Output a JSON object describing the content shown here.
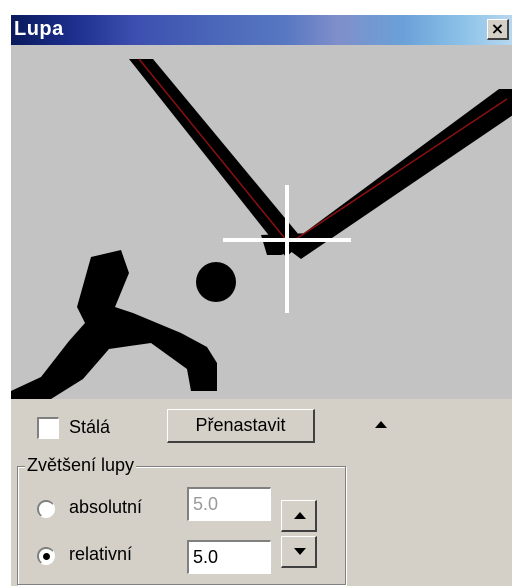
{
  "window": {
    "title": "Lupa",
    "close_icon": "close-icon",
    "close_glyph": "×"
  },
  "magnifier": {
    "crosshair_icon": "crosshair-icon",
    "colors": {
      "background": "#c3c3c3",
      "ink": "#000000",
      "guide_line": "#8b0000",
      "crosshair": "#ffffff"
    }
  },
  "controls": {
    "fixed_checkbox": {
      "label": "Stálá",
      "checked": false
    },
    "reset_button": {
      "label": "Přenastavit"
    },
    "collapse_icon": "triangle-up-icon",
    "zoom_group": {
      "label": "Zvětšení lupy",
      "absolute": {
        "label": "absolutní",
        "value": "5.0",
        "selected": false,
        "enabled": false
      },
      "relative": {
        "label": "relativní",
        "value": "5.0",
        "selected": true,
        "enabled": true
      },
      "spin_up_icon": "spin-up-icon",
      "spin_down_icon": "spin-down-icon"
    }
  }
}
